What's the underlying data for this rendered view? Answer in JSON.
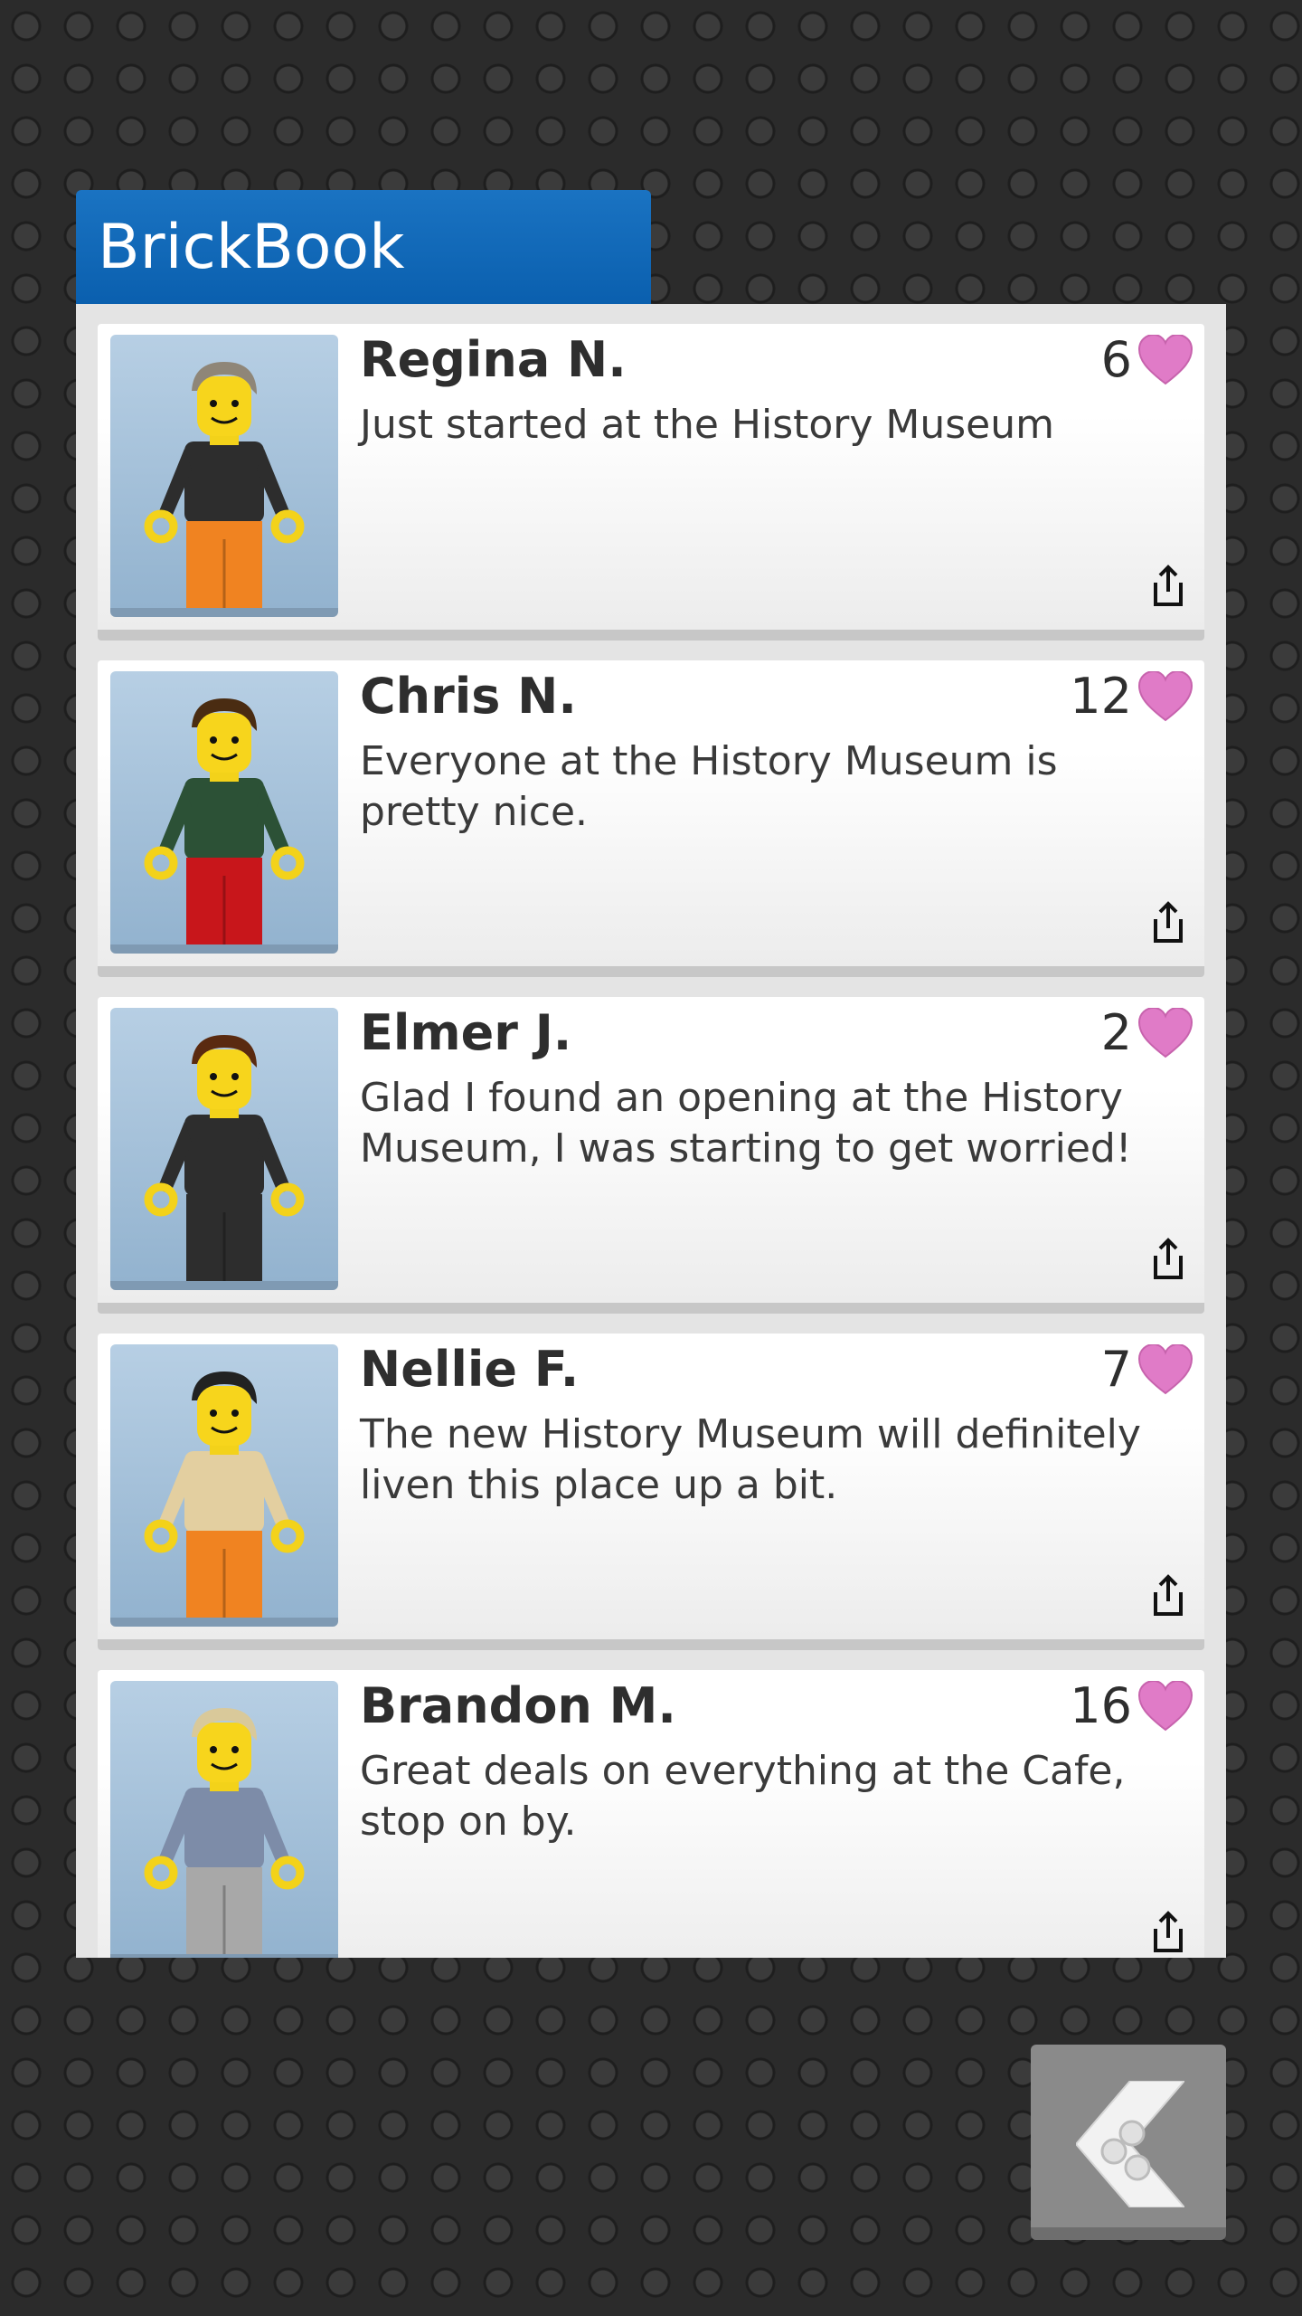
{
  "app": {
    "title": "BrickBook"
  },
  "colors": {
    "header": "#0a5fae",
    "heart": "#e07bc7"
  },
  "posts": [
    {
      "name": "Regina N.",
      "likes": "6",
      "message": "Just started at the History Museum",
      "hair": "#8f8678",
      "torso": "#2d2d2d",
      "legs": "#f08321",
      "avatar_icon": "minifigure-avatar"
    },
    {
      "name": "Chris N.",
      "likes": "12",
      "message": "Everyone at the History Museum is pretty nice.",
      "hair": "#4a2c12",
      "torso": "#2c5136",
      "legs": "#c8161b",
      "avatar_icon": "minifigure-avatar"
    },
    {
      "name": "Elmer J.",
      "likes": "2",
      "message": "Glad I found an opening at the History Museum, I was starting to get worried!",
      "hair": "#5a2a10",
      "torso": "#2d2d2d",
      "legs": "#2d2d2d",
      "avatar_icon": "minifigure-avatar"
    },
    {
      "name": "Nellie F.",
      "likes": "7",
      "message": "The new History Museum will definitely liven this place up a bit.",
      "hair": "#222222",
      "torso": "#e3cfa0",
      "legs": "#f08321",
      "avatar_icon": "minifigure-avatar"
    },
    {
      "name": "Brandon M.",
      "likes": "16",
      "message": "Great deals on everything at the Cafe, stop on by.",
      "hair": "#d9c99a",
      "torso": "#7d8ca8",
      "legs": "#a8a8a8",
      "avatar_icon": "minifigure-avatar"
    }
  ],
  "icons": {
    "like": "heart-icon",
    "share": "share-icon",
    "back": "brick-back-icon"
  }
}
